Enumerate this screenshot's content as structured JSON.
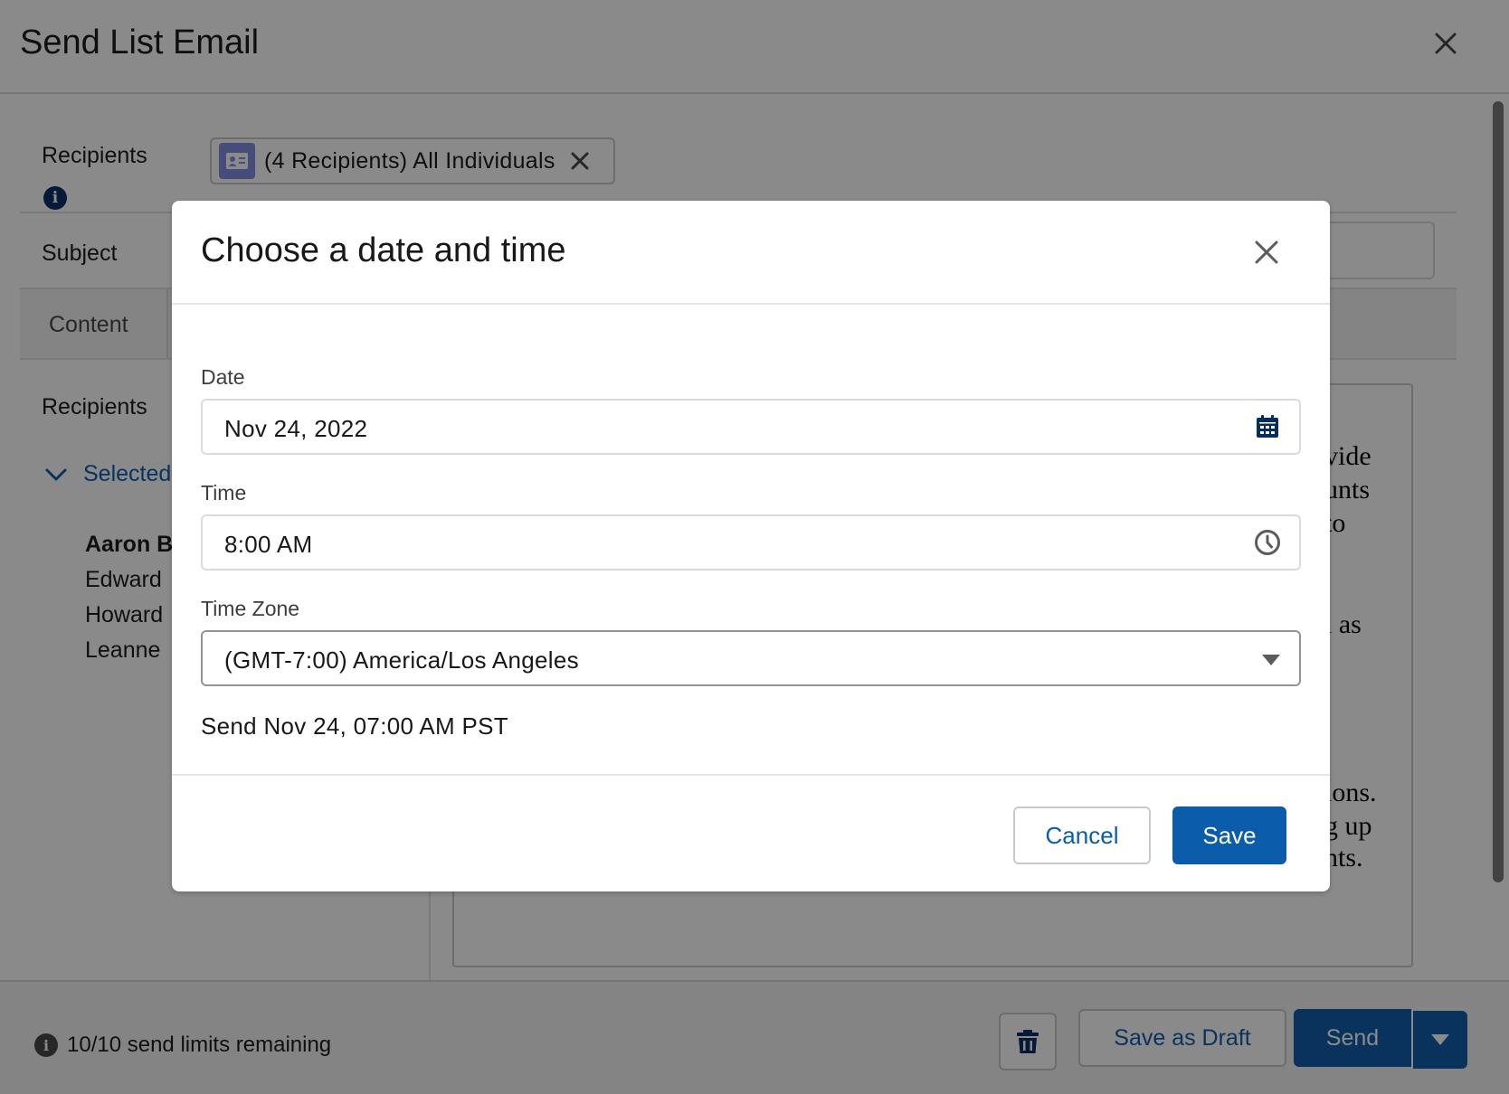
{
  "background": {
    "title": "Send List Email",
    "recipients_label": "Recipients",
    "recipient_pill": "(4 Recipients) All Individuals",
    "subject_label": "Subject",
    "content_tab": "Content",
    "recipients_section_label": "Recipients",
    "selected_label": "Selected",
    "recipient_names": [
      "Aaron B",
      "Edward",
      "Howard",
      "Leanne"
    ],
    "editor_fragments": [
      "vide",
      "unts",
      "to",
      "l as",
      "ions.",
      "g up",
      "nts."
    ],
    "footer_info": "10/10 send limits remaining",
    "save_draft_label": "Save as Draft",
    "send_label": "Send"
  },
  "modal": {
    "title": "Choose a date and time",
    "date": {
      "label": "Date",
      "value": "Nov 24, 2022"
    },
    "time": {
      "label": "Time",
      "value": "8:00 AM"
    },
    "timezone": {
      "label": "Time Zone",
      "value": "(GMT-7:00) America/Los Angeles"
    },
    "summary": "Send Nov 24, 07:00 AM PST",
    "cancel_label": "Cancel",
    "save_label": "Save"
  },
  "icons": {
    "close": "close-icon",
    "calendar": "calendar-icon",
    "clock": "clock-icon",
    "dropdown": "chevron-down-icon",
    "trash": "trash-icon",
    "contact": "contact-card-icon",
    "info": "info-icon"
  },
  "colors": {
    "brand": "#0b5cab",
    "navy": "#032d60",
    "contact_icon": "#7f8de1"
  }
}
